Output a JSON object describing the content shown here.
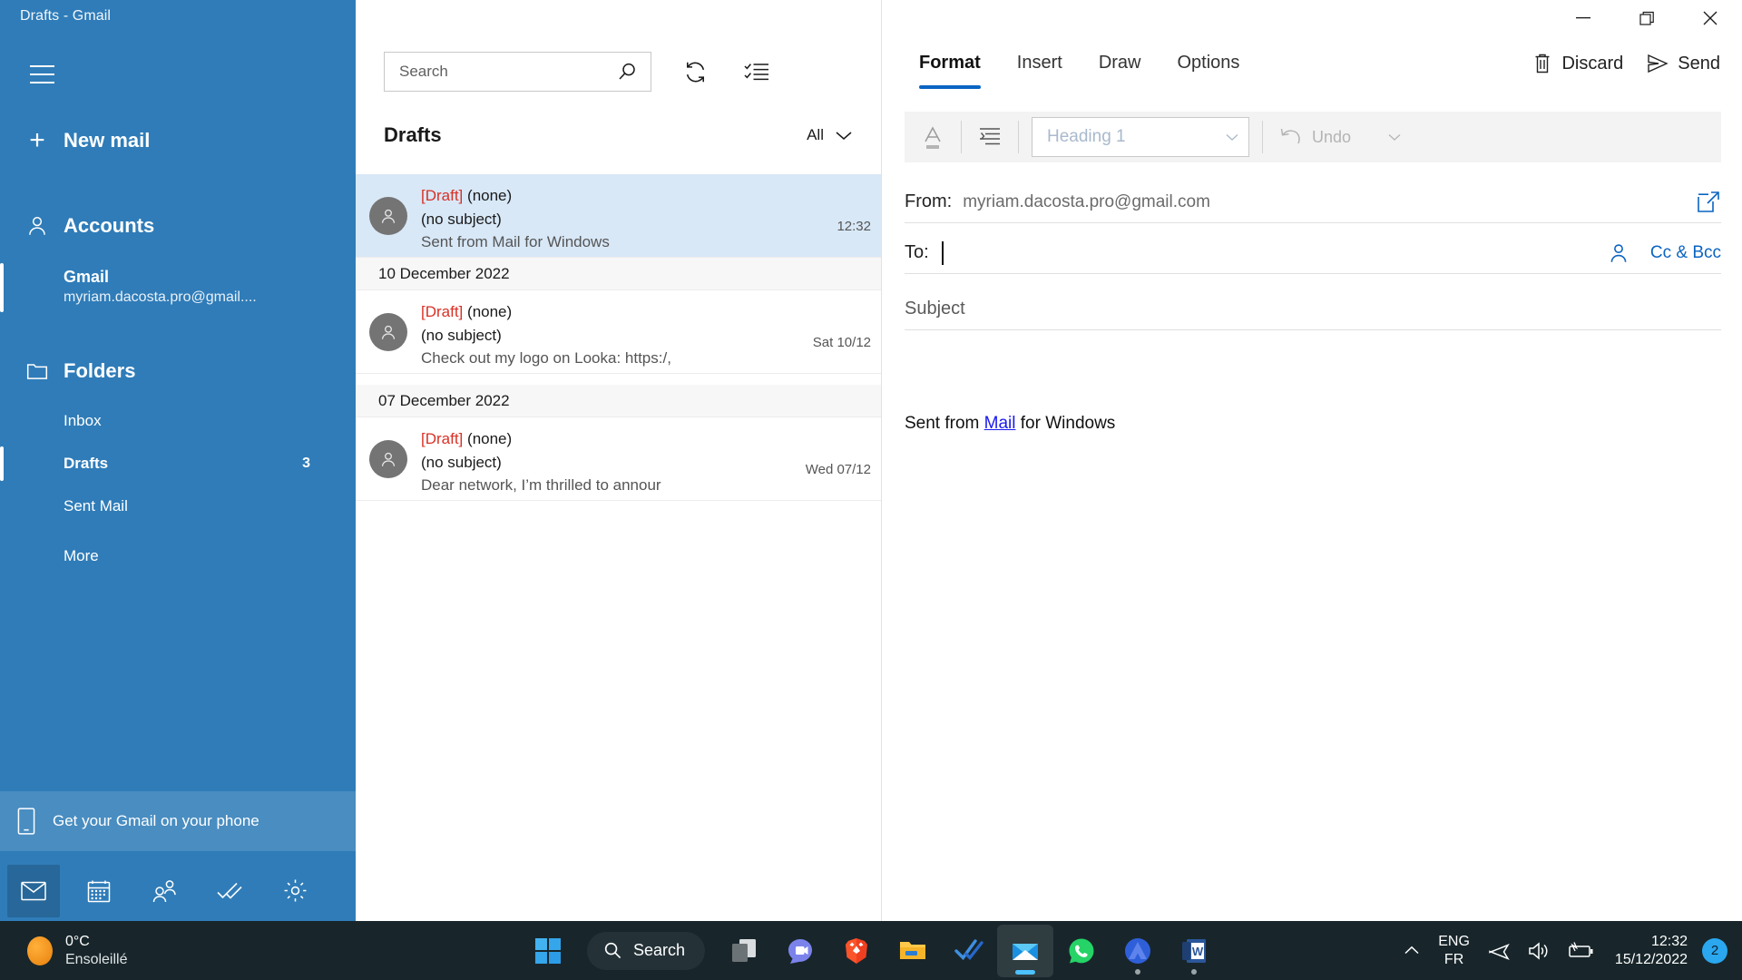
{
  "window": {
    "title": "Drafts - Gmail",
    "minimize_icon": "minimize-icon",
    "restore_icon": "restore-icon",
    "close_icon": "close-icon"
  },
  "sidebar": {
    "menu_icon": "hamburger-icon",
    "new_mail_label": "New mail",
    "accounts_label": "Accounts",
    "folders_label": "Folders",
    "account": {
      "name": "Gmail",
      "email": "myriam.dacosta.pro@gmail...."
    },
    "folders": [
      {
        "label": "Inbox",
        "count": ""
      },
      {
        "label": "Drafts",
        "count": "3"
      },
      {
        "label": "Sent Mail",
        "count": ""
      },
      {
        "label": "More",
        "count": ""
      }
    ],
    "promo_label": "Get your Gmail on your phone",
    "bottom_bar": [
      {
        "name": "mail-icon",
        "active": true
      },
      {
        "name": "calendar-icon",
        "active": false
      },
      {
        "name": "people-icon",
        "active": false
      },
      {
        "name": "tasks-icon",
        "active": false
      },
      {
        "name": "settings-icon",
        "active": false
      }
    ]
  },
  "list": {
    "search_placeholder": "Search",
    "search_value": "",
    "refresh_icon": "refresh-icon",
    "select_icon": "select-mode-icon",
    "title": "Drafts",
    "filter_label": "All",
    "items": [
      {
        "type": "message",
        "draft_tag": "[Draft]",
        "sender": "(none)",
        "subject": "(no subject)",
        "preview": "Sent from Mail for Windows",
        "time": "12:32",
        "selected": true
      },
      {
        "type": "group",
        "label": "10 December 2022"
      },
      {
        "type": "message",
        "draft_tag": "[Draft]",
        "sender": "(none)",
        "subject": "(no subject)",
        "preview": "Check out my logo on Looka: https:/,",
        "time": "Sat 10/12",
        "selected": false
      },
      {
        "type": "group",
        "label": "07 December 2022"
      },
      {
        "type": "message",
        "draft_tag": "[Draft]",
        "sender": "(none)",
        "subject": "(no subject)",
        "preview": "Dear network, I’m thrilled to annour",
        "time": "Wed 07/12",
        "selected": false
      }
    ]
  },
  "compose": {
    "tabs": [
      {
        "label": "Format",
        "active": true
      },
      {
        "label": "Insert",
        "active": false
      },
      {
        "label": "Draw",
        "active": false
      },
      {
        "label": "Options",
        "active": false
      }
    ],
    "discard_label": "Discard",
    "send_label": "Send",
    "ribbon": {
      "font_icon": "font-color-icon",
      "paragraph_icon": "paragraph-icon",
      "heading_value": "Heading 1",
      "undo_label": "Undo"
    },
    "from_label": "From:",
    "from_value": "myriam.dacosta.pro@gmail.com",
    "popout_icon": "pop-out-icon",
    "to_label": "To:",
    "to_value": "",
    "people_icon": "person-picker-icon",
    "cc_bcc_label": "Cc & Bcc",
    "subject_placeholder": "Subject",
    "subject_value": "",
    "body": {
      "before": "Sent from ",
      "link": "Mail",
      "after": " for Windows"
    }
  },
  "taskbar": {
    "weather": {
      "temperature": "0°C",
      "condition": "Ensoleillé"
    },
    "start_icon": "windows-start-icon",
    "search_label": "Search",
    "apps": [
      {
        "name": "task-view-icon",
        "indicator": "none"
      },
      {
        "name": "microsoft-teams-icon",
        "indicator": "none"
      },
      {
        "name": "brave-browser-icon",
        "indicator": "dot"
      },
      {
        "name": "file-explorer-icon",
        "indicator": "none"
      },
      {
        "name": "todo-icon",
        "indicator": "none"
      },
      {
        "name": "mail-app-icon",
        "indicator": "bar"
      },
      {
        "name": "whatsapp-icon",
        "indicator": "none"
      },
      {
        "name": "nordvpn-icon",
        "indicator": "dot"
      },
      {
        "name": "word-icon",
        "indicator": "dot"
      }
    ],
    "tray": {
      "chevron_icon": "show-hidden-icons-icon",
      "language_top": "ENG",
      "language_bottom": "FR",
      "airplane_icon": "airplane-mode-icon",
      "volume_icon": "volume-icon",
      "battery_icon": "battery-charging-icon",
      "time": "12:32",
      "date": "15/12/2022",
      "notification_count": "2"
    }
  },
  "colors": {
    "sidebar": "#2F7CB8",
    "accent": "#0a64c2",
    "draft_red": "#d93025",
    "selected_row": "#d8e8f7",
    "taskbar": "#18262b"
  }
}
